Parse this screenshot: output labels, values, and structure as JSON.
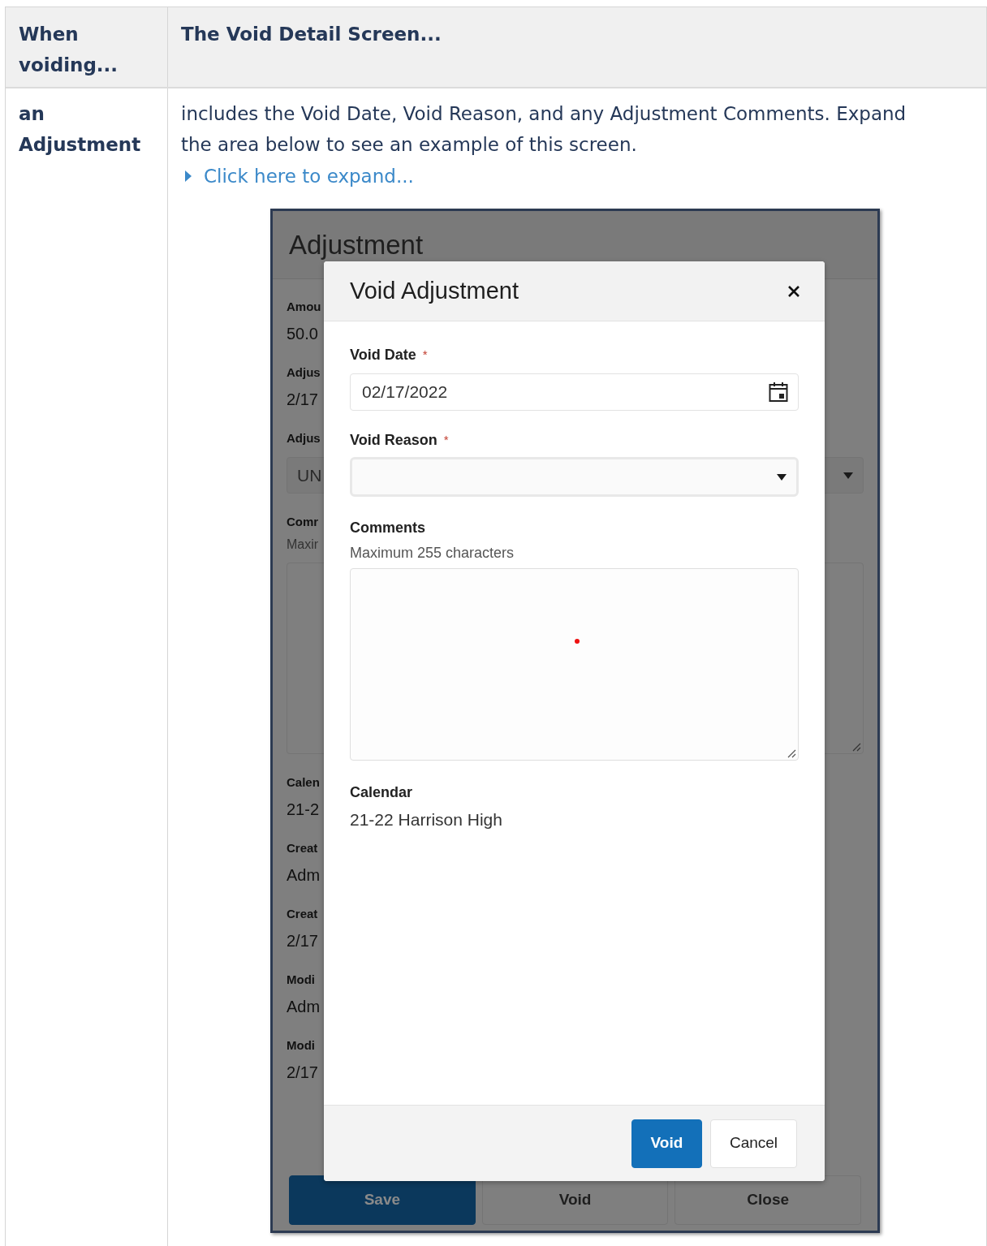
{
  "table": {
    "columns": [
      "When voiding...",
      "The Void Detail Screen..."
    ],
    "rows": [
      {
        "label": "an Adjustment",
        "description": "includes the Void Date, Void Reason, and any Adjustment Comments. Expand the area below to see an example of this screen.",
        "expand_link": "Click here to expand..."
      }
    ]
  },
  "screenshot": {
    "background": {
      "title": "Adjustment",
      "fields": [
        {
          "kind": "text",
          "label": "Amou",
          "value": "50.0"
        },
        {
          "kind": "text",
          "label": "Adjus",
          "value": "2/17"
        },
        {
          "kind": "select",
          "label": "Adjus",
          "value": "UN"
        },
        {
          "kind": "textarea",
          "label": "Comr",
          "hint": "Maxir"
        },
        {
          "kind": "text",
          "label": "Calen",
          "value": "21-2"
        },
        {
          "kind": "text",
          "label": "Creat",
          "value": "Adm"
        },
        {
          "kind": "text",
          "label": "Creat",
          "value": "2/17"
        },
        {
          "kind": "text",
          "label": "Modi",
          "value": "Adm"
        },
        {
          "kind": "text",
          "label": "Modi",
          "value": "2/17"
        }
      ],
      "buttons": [
        {
          "label": "Save",
          "primary": true
        },
        {
          "label": "Void",
          "primary": false
        },
        {
          "label": "Close",
          "primary": false
        }
      ]
    },
    "dialog": {
      "title": "Void Adjustment",
      "void_date": {
        "label": "Void Date",
        "required_mark": "*",
        "value": "02/17/2022"
      },
      "void_reason": {
        "label": "Void Reason",
        "required_mark": "*"
      },
      "comments": {
        "label": "Comments",
        "hint": "Maximum 255 characters"
      },
      "calendar": {
        "label": "Calendar",
        "value": "21-22 Harrison High"
      },
      "buttons": [
        {
          "label": "Void",
          "primary": true
        },
        {
          "label": "Cancel",
          "primary": false
        }
      ]
    }
  }
}
